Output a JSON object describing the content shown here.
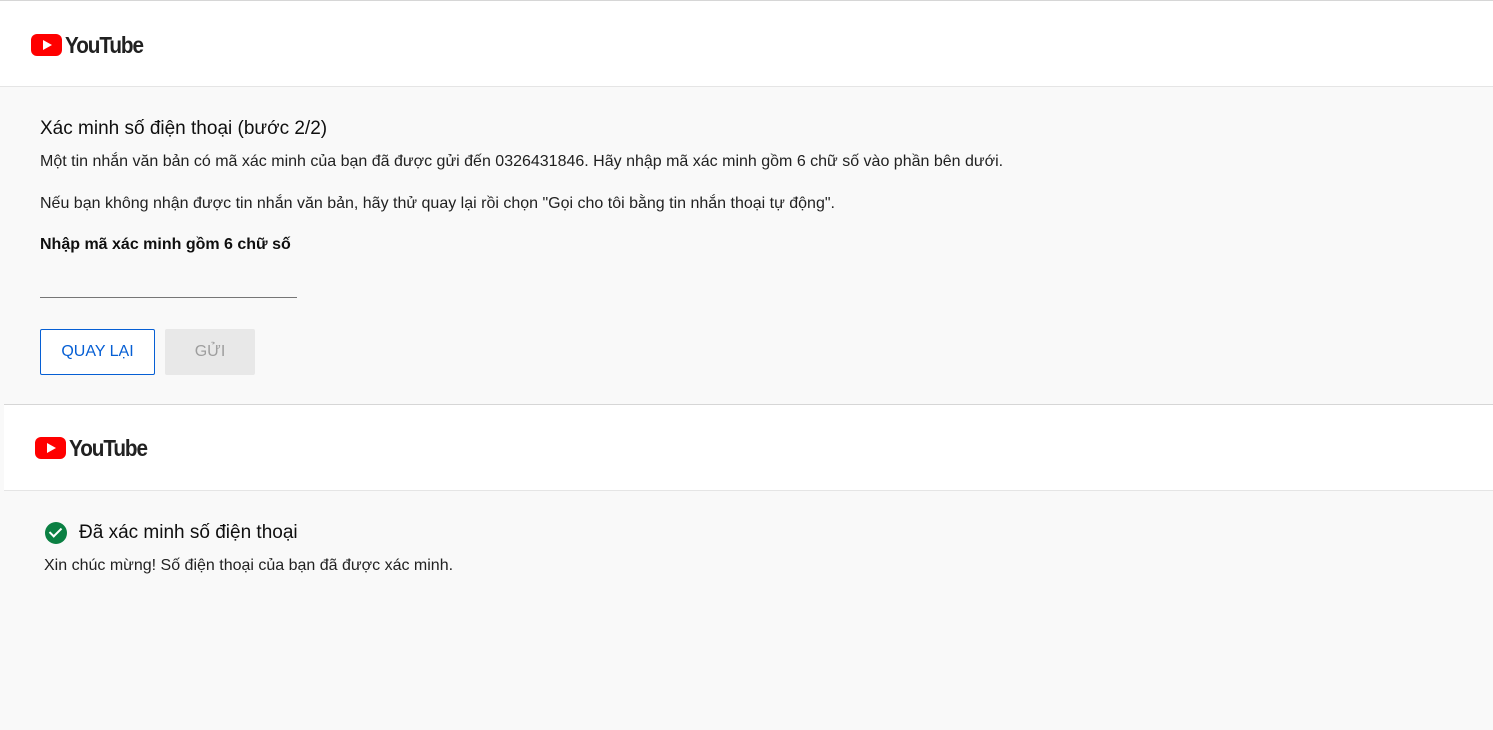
{
  "brand": {
    "name": "YouTube",
    "colors": {
      "red": "#ff0000",
      "accent_blue": "#065fd4",
      "success_green": "#0b8043"
    }
  },
  "step_two": {
    "title": "Xác minh số điện thoại (bước 2/2)",
    "paragraph1": "Một tin nhắn văn bản có mã xác minh của bạn đã được gửi đến 0326431846. Hãy nhập mã xác minh gồm 6 chữ số vào phần bên dưới.",
    "paragraph2": "Nếu bạn không nhận được tin nhắn văn bản, hãy thử quay lại rồi chọn \"Gọi cho tôi bằng tin nhắn thoại tự động\".",
    "code_label": "Nhập mã xác minh gồm 6 chữ số",
    "code_value": "",
    "buttons": {
      "back": "QUAY LẠI",
      "send": "GỬI"
    }
  },
  "verified": {
    "icon": "check-circle-icon",
    "title": "Đã xác minh số điện thoại",
    "message": "Xin chúc mừng! Số điện thoại của bạn đã được xác minh."
  }
}
